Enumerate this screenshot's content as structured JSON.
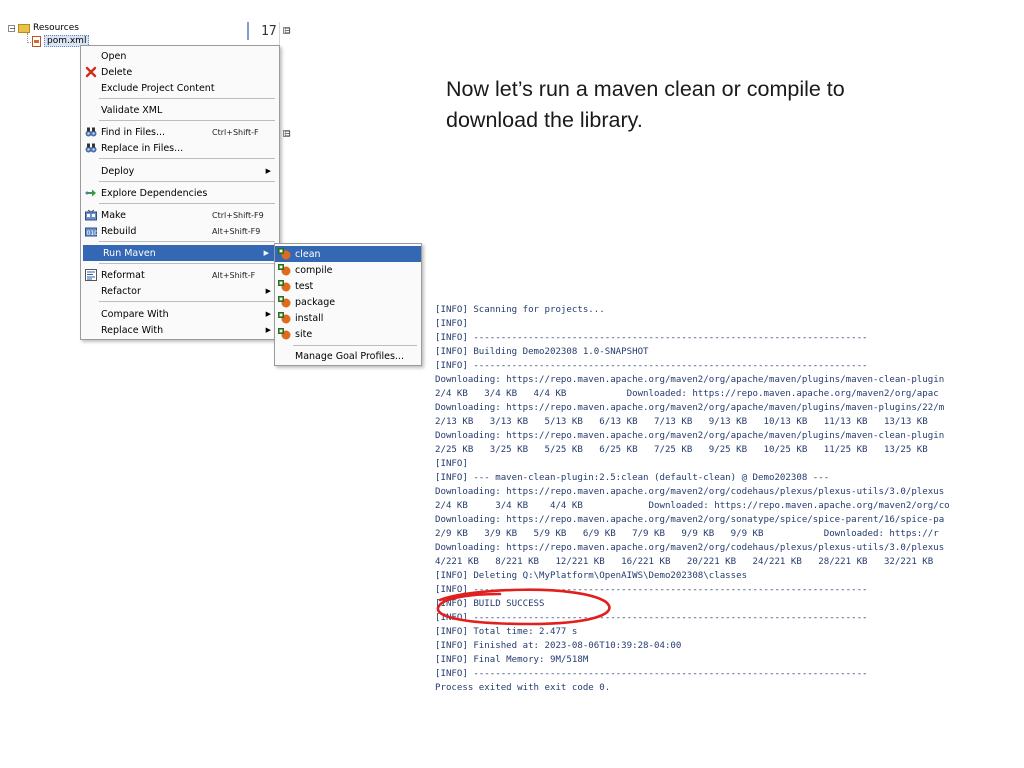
{
  "tree": {
    "resources_label": "Resources",
    "file_label": "pom.xml"
  },
  "editor": {
    "line_number": "17",
    "fold_symbol": "⊟"
  },
  "context_menu": {
    "items": [
      {
        "label": "Open",
        "shortcut": "",
        "icon": "",
        "submenu": false
      },
      {
        "label": "Delete",
        "shortcut": "",
        "icon": "delete-x-icon",
        "submenu": false
      },
      {
        "label": "Exclude Project Content",
        "shortcut": "",
        "icon": "",
        "submenu": false
      },
      {
        "label": "Validate XML",
        "shortcut": "",
        "icon": "",
        "submenu": false
      },
      {
        "label": "Find in Files...",
        "shortcut": "Ctrl+Shift-F",
        "icon": "binoculars-icon",
        "submenu": false
      },
      {
        "label": "Replace in Files...",
        "shortcut": "",
        "icon": "binoculars-icon",
        "submenu": false
      },
      {
        "label": "Deploy",
        "shortcut": "",
        "icon": "",
        "submenu": true
      },
      {
        "label": "Explore Dependencies",
        "shortcut": "",
        "icon": "dependencies-arrow-icon",
        "submenu": false
      },
      {
        "label": "Make",
        "shortcut": "Ctrl+Shift-F9",
        "icon": "make-icon",
        "submenu": false
      },
      {
        "label": "Rebuild",
        "shortcut": "Alt+Shift-F9",
        "icon": "rebuild-icon",
        "submenu": false
      },
      {
        "label": "Run Maven",
        "shortcut": "",
        "icon": "",
        "submenu": true,
        "selected": true
      },
      {
        "label": "Reformat",
        "shortcut": "Alt+Shift-F",
        "icon": "reformat-icon",
        "submenu": false
      },
      {
        "label": "Refactor",
        "shortcut": "",
        "icon": "",
        "submenu": true
      },
      {
        "label": "Compare With",
        "shortcut": "",
        "icon": "",
        "submenu": true
      },
      {
        "label": "Replace With",
        "shortcut": "",
        "icon": "",
        "submenu": true
      }
    ]
  },
  "run_maven_submenu": {
    "goals": [
      "clean",
      "compile",
      "test",
      "package",
      "install",
      "site"
    ],
    "selected_goal": "clean",
    "manage_label": "Manage Goal Profiles..."
  },
  "instruction": {
    "text": "Now let’s run a maven clean or compile to download the library."
  },
  "console": {
    "lines": [
      "[INFO] Scanning for projects...",
      "[INFO]",
      "[INFO] ------------------------------------------------------------------------",
      "[INFO] Building Demo202308 1.0-SNAPSHOT",
      "[INFO] ------------------------------------------------------------------------",
      "Downloading: https://repo.maven.apache.org/maven2/org/apache/maven/plugins/maven-clean-plugin",
      "2/4 KB   3/4 KB   4/4 KB           Downloaded: https://repo.maven.apache.org/maven2/org/apac",
      "Downloading: https://repo.maven.apache.org/maven2/org/apache/maven/plugins/maven-plugins/22/m",
      "2/13 KB   3/13 KB   5/13 KB   6/13 KB   7/13 KB   9/13 KB   10/13 KB   11/13 KB   13/13 KB",
      "Downloading: https://repo.maven.apache.org/maven2/org/apache/maven/plugins/maven-clean-plugin",
      "2/25 KB   3/25 KB   5/25 KB   6/25 KB   7/25 KB   9/25 KB   10/25 KB   11/25 KB   13/25 KB",
      "[INFO]",
      "[INFO] --- maven-clean-plugin:2.5:clean (default-clean) @ Demo202308 ---",
      "Downloading: https://repo.maven.apache.org/maven2/org/codehaus/plexus/plexus-utils/3.0/plexus",
      "2/4 KB     3/4 KB    4/4 KB            Downloaded: https://repo.maven.apache.org/maven2/org/co",
      "Downloading: https://repo.maven.apache.org/maven2/org/sonatype/spice/spice-parent/16/spice-pa",
      "2/9 KB   3/9 KB   5/9 KB   6/9 KB   7/9 KB   9/9 KB   9/9 KB           Downloaded: https://r",
      "Downloading: https://repo.maven.apache.org/maven2/org/codehaus/plexus/plexus-utils/3.0/plexus",
      "4/221 KB   8/221 KB   12/221 KB   16/221 KB   20/221 KB   24/221 KB   28/221 KB   32/221 KB",
      "[INFO] Deleting Q:\\MyPlatform\\OpenAIWS\\Demo202308\\classes",
      "[INFO] ------------------------------------------------------------------------",
      "[INFO] BUILD SUCCESS",
      "[INFO] ------------------------------------------------------------------------",
      "[INFO] Total time: 2.477 s",
      "[INFO] Finished at: 2023-08-06T10:39:28-04:00",
      "[INFO] Final Memory: 9M/518M",
      "[INFO] ------------------------------------------------------------------------",
      "Process exited with exit code 0."
    ]
  },
  "colors": {
    "selection": "#3568b4",
    "console_text": "#243c6e",
    "annotation_circle": "#e0201e"
  }
}
